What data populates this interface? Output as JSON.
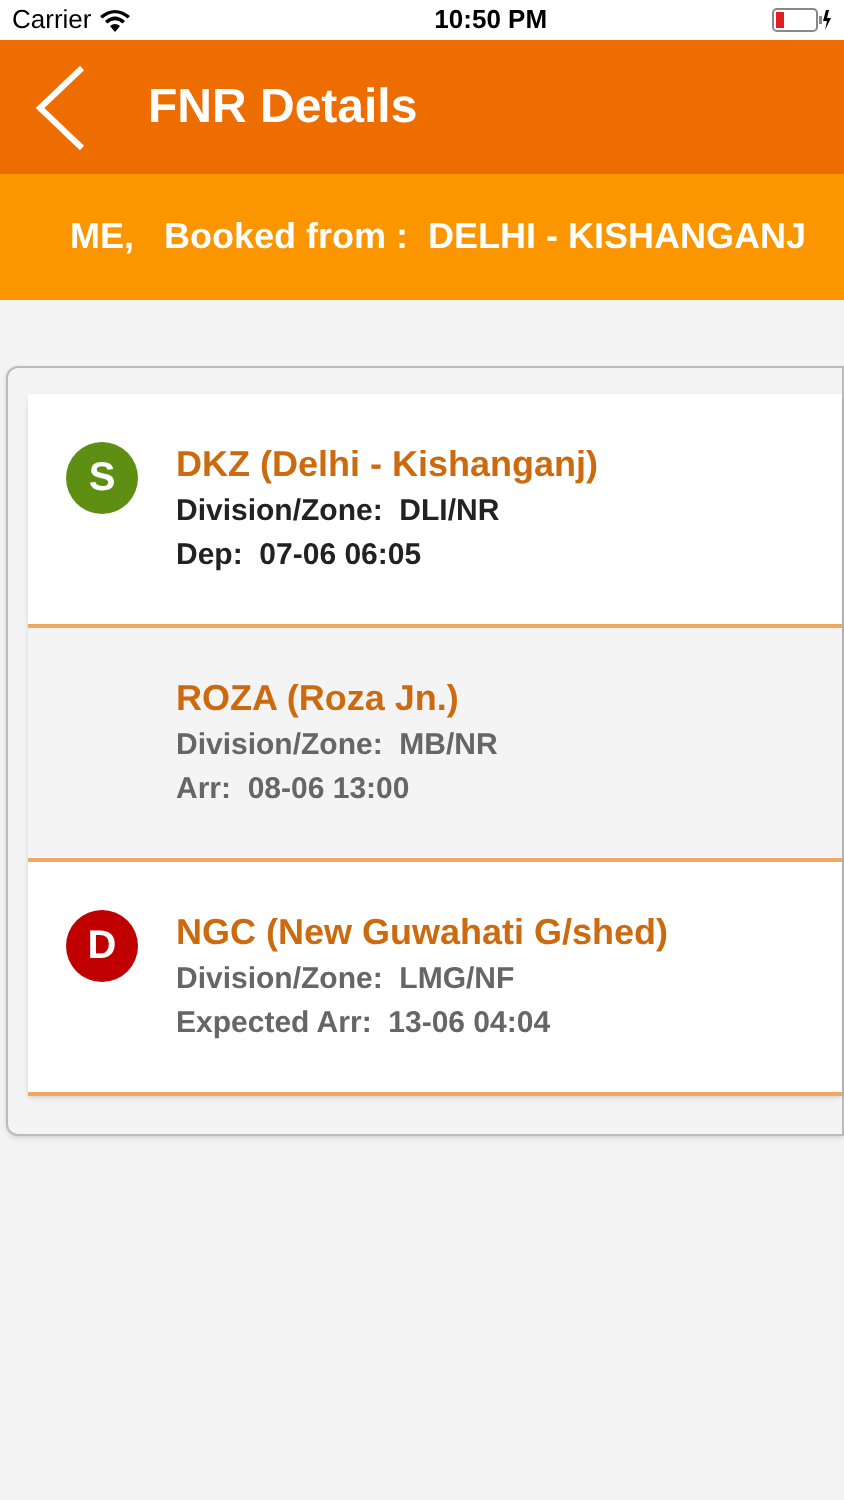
{
  "status_bar": {
    "carrier": "Carrier",
    "time": "10:50 PM"
  },
  "header": {
    "title": "FNR Details"
  },
  "banner": {
    "text": "ME,   Booked from :  DELHI - KISHANGANJ"
  },
  "stops": [
    {
      "kind": "source",
      "badge": "S",
      "color": "#5f8f12",
      "station": "DKZ (Delhi - Kishanganj)",
      "division": "Division/Zone:  DLI/NR",
      "time": "Dep:  07-06 06:05"
    },
    {
      "kind": "intermediate",
      "station": "ROZA (Roza Jn.)",
      "division": "Division/Zone:  MB/NR",
      "time": "Arr:  08-06 13:00"
    },
    {
      "kind": "destination",
      "badge": "D",
      "color": "#c00000",
      "station": "NGC (New Guwahati G/shed)",
      "division": "Division/Zone:  LMG/NF",
      "time": "Expected Arr:  13-06 04:04"
    }
  ]
}
